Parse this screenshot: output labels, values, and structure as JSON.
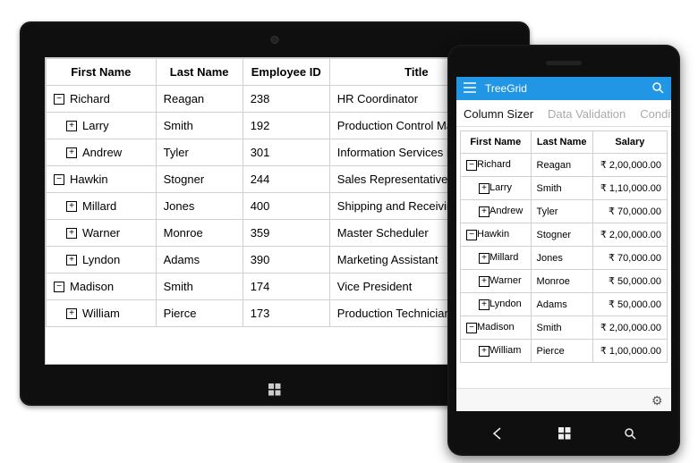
{
  "tablet": {
    "columns": {
      "first": "First Name",
      "last": "Last Name",
      "emp": "Employee ID",
      "title": "Title"
    },
    "rows": [
      {
        "level": 0,
        "expanded": true,
        "first": "Richard",
        "last": "Reagan",
        "emp": "238",
        "title": "HR Coordinator"
      },
      {
        "level": 1,
        "expanded": false,
        "first": "Larry",
        "last": "Smith",
        "emp": "192",
        "title": "Production Control Manager"
      },
      {
        "level": 1,
        "expanded": false,
        "first": "Andrew",
        "last": "Tyler",
        "emp": "301",
        "title": "Information Services Manager"
      },
      {
        "level": 0,
        "expanded": true,
        "first": "Hawkin",
        "last": "Stogner",
        "emp": "244",
        "title": "Sales Representative"
      },
      {
        "level": 1,
        "expanded": false,
        "first": "Millard",
        "last": "Jones",
        "emp": "400",
        "title": "Shipping and Receiving Clerk"
      },
      {
        "level": 1,
        "expanded": false,
        "first": "Warner",
        "last": "Monroe",
        "emp": "359",
        "title": "Master Scheduler"
      },
      {
        "level": 1,
        "expanded": false,
        "first": "Lyndon",
        "last": "Adams",
        "emp": "390",
        "title": "Marketing Assistant"
      },
      {
        "level": 0,
        "expanded": true,
        "first": "Madison",
        "last": "Smith",
        "emp": "174",
        "title": "Vice President"
      },
      {
        "level": 1,
        "expanded": false,
        "first": "William",
        "last": "Pierce",
        "emp": "173",
        "title": "Production Technician"
      }
    ]
  },
  "phone": {
    "app_title": "TreeGrid",
    "tabs": [
      "Column Sizer",
      "Data Validation",
      "Condit"
    ],
    "active_tab": 0,
    "columns": {
      "first": "First Name",
      "last": "Last Name",
      "salary": "Salary"
    },
    "rows": [
      {
        "level": 0,
        "expanded": true,
        "first": "Richard",
        "last": "Reagan",
        "salary": "₹ 2,00,000.00"
      },
      {
        "level": 1,
        "expanded": false,
        "first": "Larry",
        "last": "Smith",
        "salary": "₹ 1,10,000.00"
      },
      {
        "level": 1,
        "expanded": false,
        "first": "Andrew",
        "last": "Tyler",
        "salary": "₹ 70,000.00"
      },
      {
        "level": 0,
        "expanded": true,
        "first": "Hawkin",
        "last": "Stogner",
        "salary": "₹ 2,00,000.00"
      },
      {
        "level": 1,
        "expanded": false,
        "first": "Millard",
        "last": "Jones",
        "salary": "₹ 70,000.00"
      },
      {
        "level": 1,
        "expanded": false,
        "first": "Warner",
        "last": "Monroe",
        "salary": "₹ 50,000.00"
      },
      {
        "level": 1,
        "expanded": false,
        "first": "Lyndon",
        "last": "Adams",
        "salary": "₹ 50,000.00"
      },
      {
        "level": 0,
        "expanded": true,
        "first": "Madison",
        "last": "Smith",
        "salary": "₹ 2,00,000.00"
      },
      {
        "level": 1,
        "expanded": false,
        "first": "William",
        "last": "Pierce",
        "salary": "₹ 1,00,000.00"
      }
    ]
  }
}
